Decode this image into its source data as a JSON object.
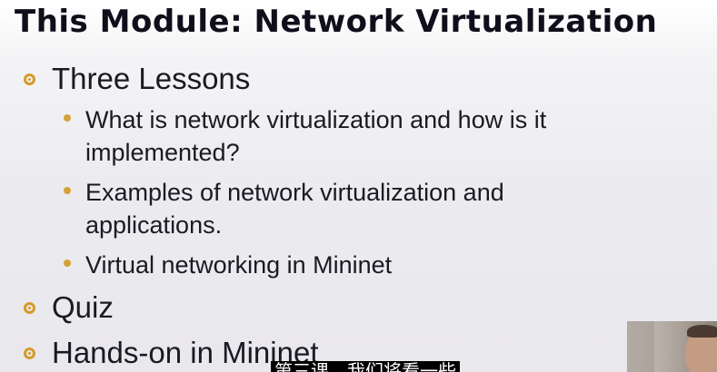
{
  "slide": {
    "title": "This Module: Network Virtualization",
    "bullets": [
      {
        "text": "Three Lessons",
        "sub": [
          {
            "line1": "What is network virtualization and how is it",
            "line2": "implemented?"
          },
          {
            "line1": "Examples of network virtualization and",
            "line2": "applications."
          },
          {
            "line1": "Virtual networking in Mininet",
            "line2": ""
          }
        ]
      },
      {
        "text": "Quiz",
        "sub": []
      },
      {
        "text": "Hands-on in Mininet",
        "sub": []
      }
    ]
  },
  "subtitle": {
    "text": "第三课，我们将看一些"
  },
  "colors": {
    "bullet_accent": "#d49b2b",
    "title_text": "#0e0f1a",
    "background": "#ebeaef"
  },
  "icons": {
    "level1_bullet": "ring-bullet-icon",
    "level2_bullet": "dot-bullet-icon"
  }
}
